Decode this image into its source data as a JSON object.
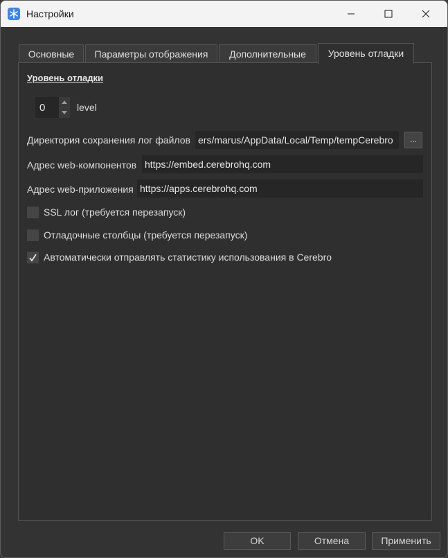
{
  "window": {
    "title": "Настройки",
    "icon": "snowflake-icon"
  },
  "tabs": [
    {
      "label": "Основные",
      "active": false
    },
    {
      "label": "Параметры отображения",
      "active": false
    },
    {
      "label": "Дополнительные",
      "active": false
    },
    {
      "label": "Уровень отладки",
      "active": true
    }
  ],
  "section": {
    "title": "Уровень отладки"
  },
  "debug_level": {
    "value": "0",
    "unit_label": "level"
  },
  "fields": {
    "log_dir": {
      "label": "Директория сохранения лог файлов",
      "value": "ers/marus/AppData/Local/Temp/tempCerebro",
      "browse_label": "..."
    },
    "web_components": {
      "label": "Адрес web-компонентов",
      "value": "https://embed.cerebrohq.com"
    },
    "web_app": {
      "label": "Адрес web-приложения",
      "value": "https://apps.cerebrohq.com"
    }
  },
  "checkboxes": [
    {
      "label": "SSL лог (требуется перезапуск)",
      "checked": false
    },
    {
      "label": "Отладочные столбцы (требуется перезапуск)",
      "checked": false
    },
    {
      "label": "Автоматически отправлять статистику использования в Cerebro",
      "checked": true
    }
  ],
  "buttons": {
    "ok": "OK",
    "cancel": "Отмена",
    "apply": "Применить"
  },
  "colors": {
    "accent": "#3a86f0",
    "background": "#333333",
    "panel": "#2f2f2f",
    "titlebar": "#f3f3f3"
  }
}
